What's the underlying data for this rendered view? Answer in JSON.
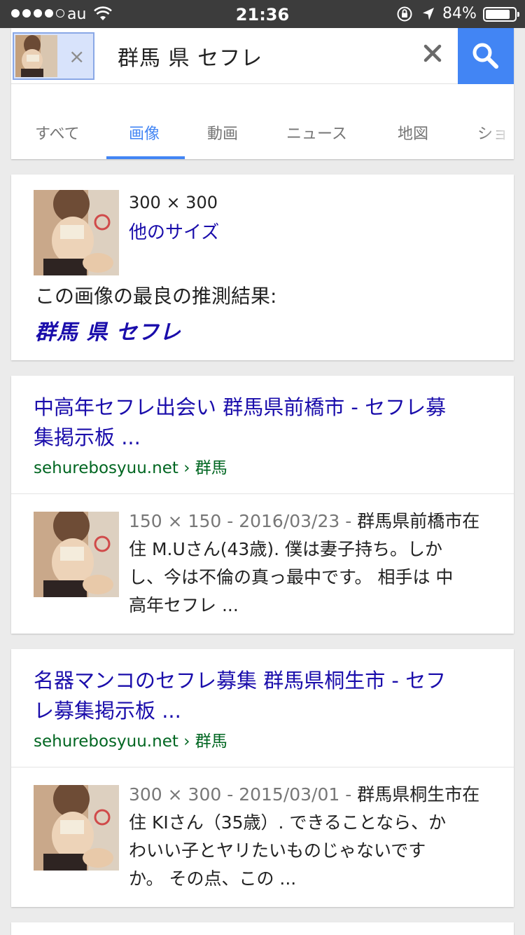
{
  "status_bar": {
    "carrier": "au",
    "time": "21:36",
    "battery": "84%",
    "battery_level": 0.84
  },
  "search": {
    "query": "群馬 県 セフレ",
    "chip_remove": "×"
  },
  "tabs": [
    {
      "label": "すべて"
    },
    {
      "label": "画像"
    },
    {
      "label": "動画"
    },
    {
      "label": "ニュース"
    },
    {
      "label": "地図"
    },
    {
      "label": "ショ"
    }
  ],
  "active_tab": "画像",
  "image_info": {
    "dimensions": "300 × 300",
    "other_sizes": "他のサイズ",
    "best_guess_label": "この画像の最良の推測結果:",
    "best_guess": "群馬 県 セフレ"
  },
  "results": [
    {
      "title_line1": "中高年セフレ出会い 群馬県前橋市 - セフレ募",
      "title_line2": "集掲示板 ...",
      "domain": "sehurebosyuu.net",
      "breadcrumb": "群馬",
      "meta": "150 × 150 - 2016/03/23 -",
      "snippet_line1": "群馬県前橋市在",
      "snippet_line2": "住 M.Uさん(43歳). 僕は妻子持ち。しか",
      "snippet_line3": "し、今は不倫の真っ最中です。 相手は 中",
      "snippet_line4": "高年セフレ ..."
    },
    {
      "title_line1": "名器マンコのセフレ募集 群馬県桐生市 - セフ",
      "title_line2": "レ募集掲示板 ...",
      "domain": "sehurebosyuu.net",
      "breadcrumb": "群馬",
      "meta": "300 × 300 - 2015/03/01 -",
      "snippet_line1": "群馬県桐生市在",
      "snippet_line2": "住 KIさん（35歳）. できることなら、か",
      "snippet_line3": "わいい子とヤリたいものじゃないです",
      "snippet_line4": "か。 その点、この ..."
    }
  ]
}
